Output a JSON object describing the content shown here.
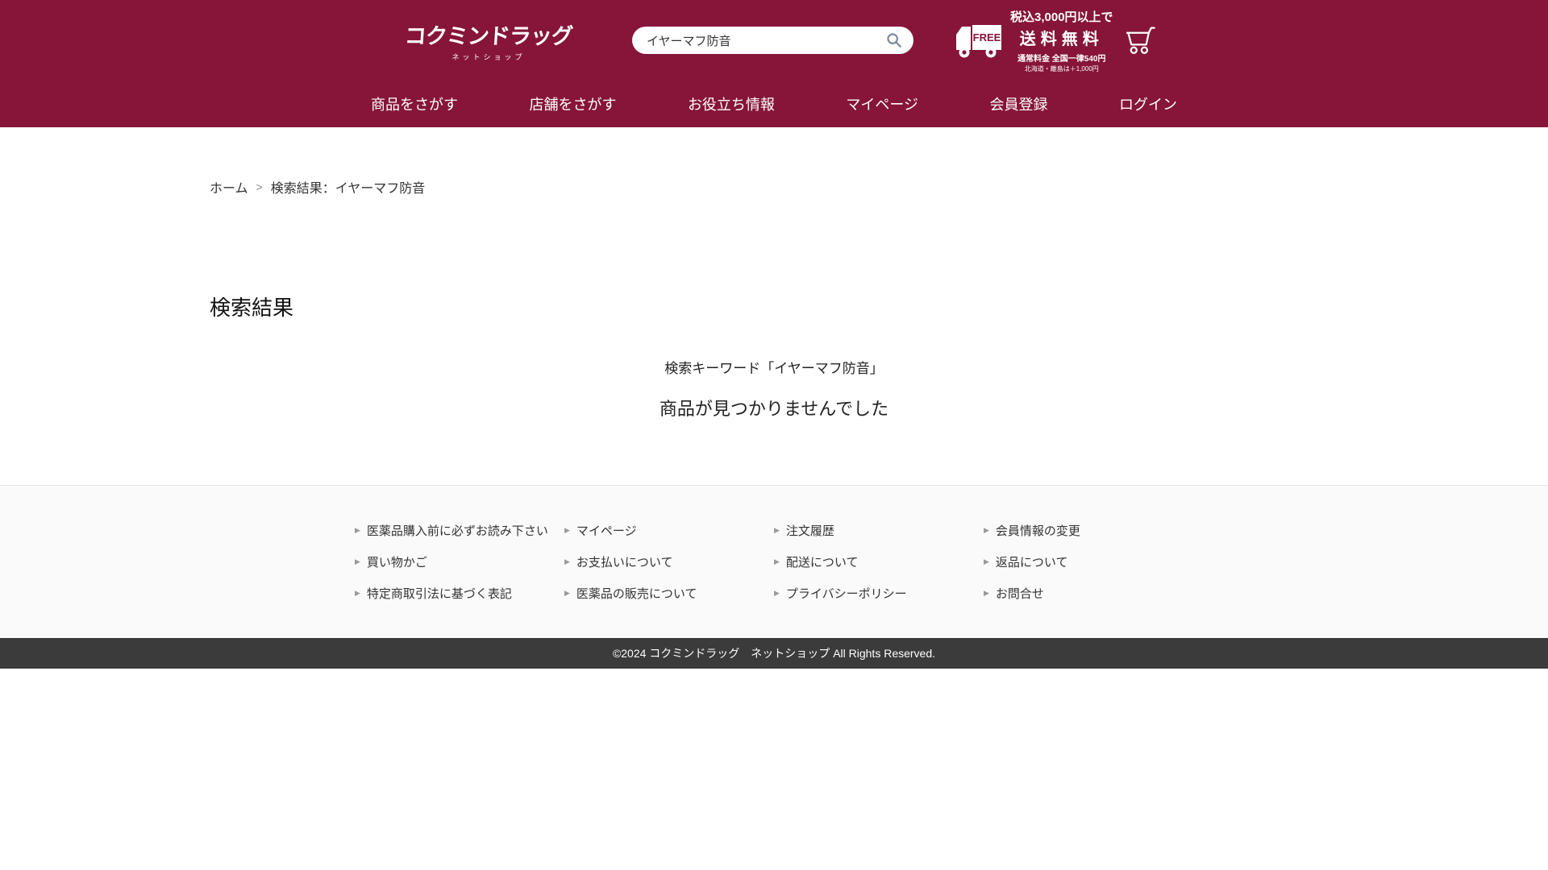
{
  "header": {
    "logo": {
      "title": "コクミンドラッグ",
      "subtitle": "ネットショップ"
    },
    "search": {
      "value": "イヤーマフ防音"
    },
    "shipping": {
      "badge": "FREE",
      "line1": "税込3,000円以上で",
      "line2": "送料無料",
      "line3": "通常料金 全国一律540円",
      "line4": "北海道・離島は＋1,000円"
    },
    "nav": [
      {
        "label": "商品をさがす"
      },
      {
        "label": "店舗をさがす"
      },
      {
        "label": "お役立ち情報"
      },
      {
        "label": "マイページ"
      },
      {
        "label": "会員登録"
      },
      {
        "label": "ログイン"
      }
    ]
  },
  "breadcrumb": {
    "home": "ホーム",
    "separator": ">",
    "current": "検索結果：イヤーマフ防音"
  },
  "main": {
    "title": "検索結果",
    "keyword_message": "検索キーワード「イヤーマフ防音」",
    "no_results_message": "商品が見つかりませんでした"
  },
  "footer": {
    "bullet": "▶",
    "columns": [
      {
        "links": [
          "医薬品購入前に必ずお読み下さい",
          "買い物かご",
          "特定商取引法に基づく表記"
        ]
      },
      {
        "links": [
          "マイページ",
          "お支払いについて",
          "医薬品の販売について"
        ]
      },
      {
        "links": [
          "注文履歴",
          "配送について",
          "プライバシーポリシー"
        ]
      },
      {
        "links": [
          "会員情報の変更",
          "返品について",
          "お問合せ"
        ]
      }
    ],
    "copyright": "©2024 コクミンドラッグ　ネットショップ All Rights Reserved."
  },
  "colors": {
    "brand": "#861539",
    "copyright_bg": "#3b3b3b",
    "search_icon": "#7d8b99"
  }
}
